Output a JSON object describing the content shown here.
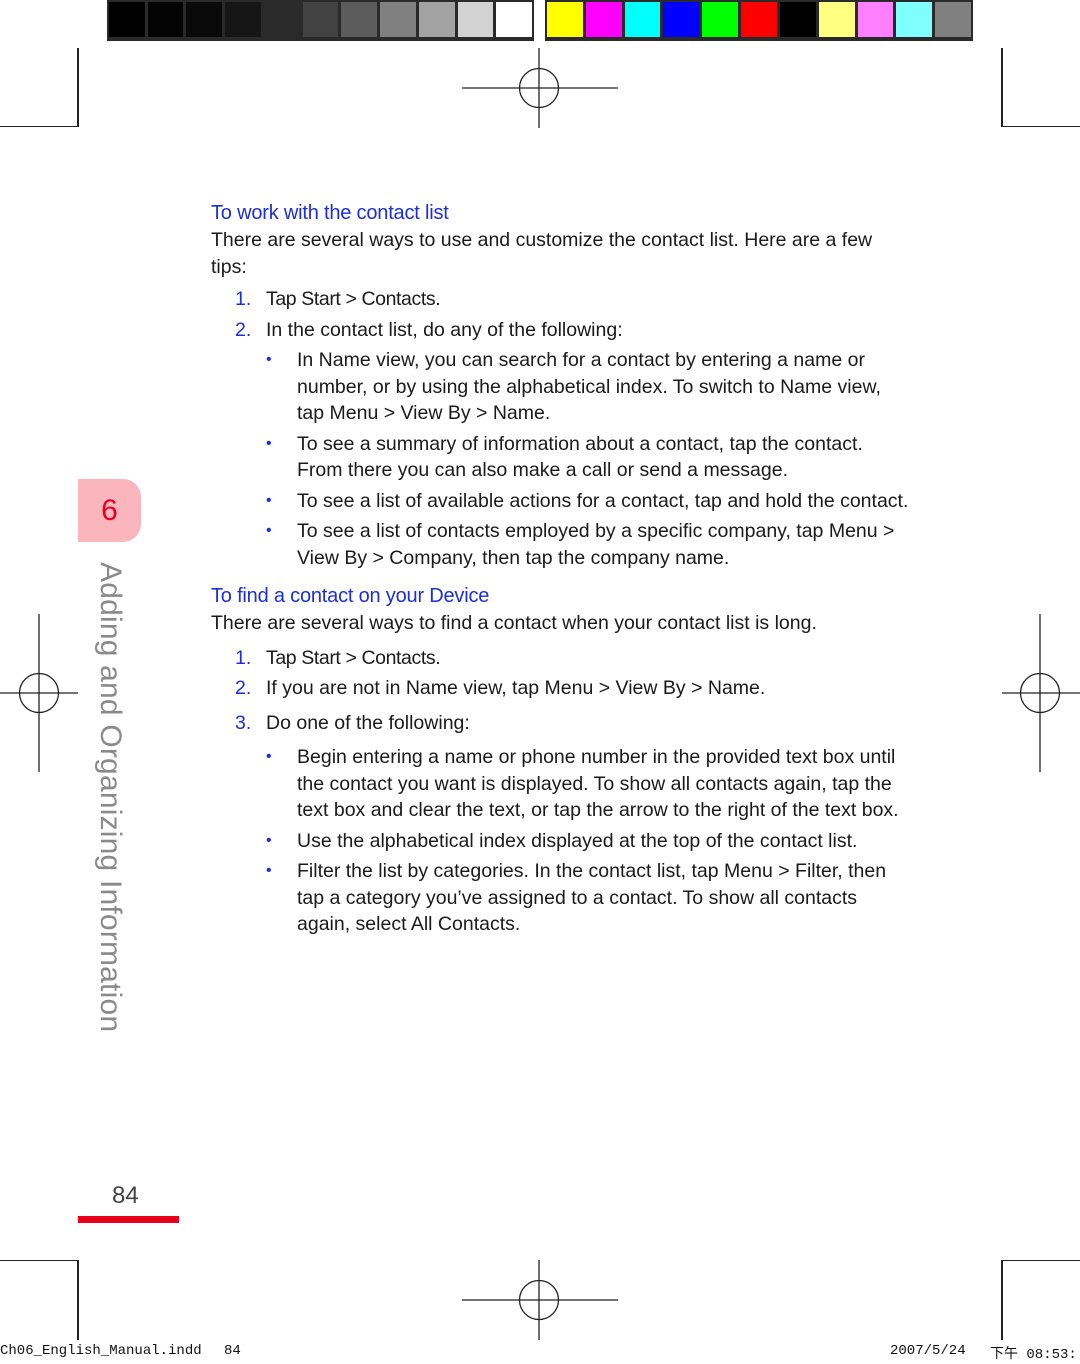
{
  "color_bars": {
    "gray": [
      "#000000",
      "#030303",
      "#0a0a0a",
      "#161616",
      "#2a2a2a",
      "#424242",
      "#5c5c5c",
      "#808080",
      "#a2a2a2",
      "#d2d2d2",
      "#ffffff"
    ],
    "color": [
      "#ffff00",
      "#ff00ff",
      "#00ffff",
      "#0000ff",
      "#00ff00",
      "#ff0000",
      "#000000",
      "#ffff80",
      "#ff80ff",
      "#80ffff",
      "#808080"
    ]
  },
  "chapter": {
    "number": "6",
    "title": "Adding and Organizing Information",
    "tab_color": "#fbb5bd",
    "accent": "#e8001c"
  },
  "section1": {
    "heading": "To work with the contact list",
    "intro": "There are several ways to use and customize the contact list. Here are a few tips:",
    "steps": [
      {
        "num": "1.",
        "text": "Tap Start > Contacts."
      },
      {
        "num": "2.",
        "text": "In the contact list, do any of the following:"
      }
    ],
    "bullets": [
      "In Name view, you can search for a contact by entering a name or number, or by using the alphabetical index. To switch to Name view, tap Menu > View By > Name.",
      "To see a summary of information about a contact, tap the contact. From there you can also make a call or send a message.",
      "To see a list of available actions for a contact, tap and hold the contact.",
      "To see a list of contacts employed by a specific company, tap Menu > View By > Company, then tap the company name."
    ]
  },
  "section2": {
    "heading": "To find a contact on your Device",
    "intro": "There are several ways to find a contact when your contact list is long.",
    "steps": [
      {
        "num": "1.",
        "text": "Tap Start > Contacts."
      },
      {
        "num": "2.",
        "text": "If you are not in Name view, tap Menu > View By > Name."
      },
      {
        "num": "3.",
        "text": "Do one of the following:"
      }
    ],
    "bullets": [
      "Begin entering a name or phone number in the provided text box until the contact you want is displayed. To show all contacts again, tap the text box and clear the text, or tap the arrow to the right of the text box.",
      "Use the alphabetical index displayed at the top of the contact list.",
      "Filter the list by categories. In the contact list, tap Menu > Filter, then tap a category you’ve assigned to a contact. To show all contacts again, select All Contacts."
    ]
  },
  "bullet_glyph": "•",
  "page_number": "84",
  "slug": {
    "file": "Ch06_English_Manual.indd",
    "page": "84",
    "date": "2007/5/24",
    "time": "下午 08:53:"
  },
  "heading_color": "#1a2fd6"
}
